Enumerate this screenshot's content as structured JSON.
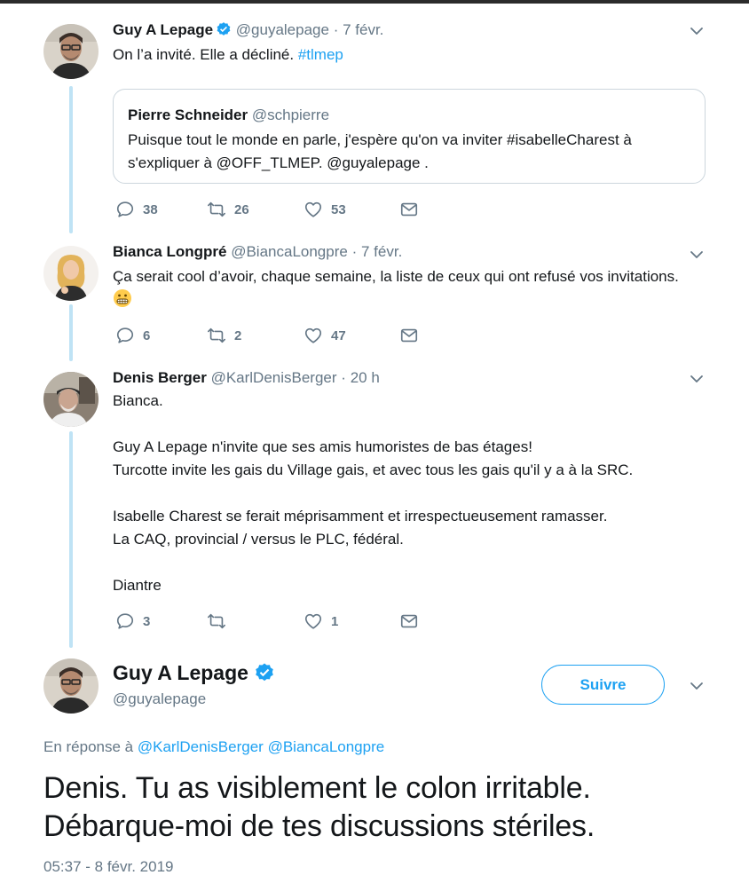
{
  "colors": {
    "accent": "#1da1f2",
    "muted": "#657786",
    "thread_line": "#bfe3f5",
    "border": "#ccd6dd"
  },
  "tweets": [
    {
      "name": "Guy A Lepage",
      "verified": true,
      "handle": "@guyalepage",
      "dot": "·",
      "time": "7 févr.",
      "text": "On l’a invité. Elle a décliné. ",
      "hashtag": "#tlmep",
      "quote": {
        "name": "Pierre Schneider",
        "handle": "@schpierre",
        "text": "Puisque tout le monde en parle, j'espère qu'on va inviter #isabelleCharest à s'expliquer à @OFF_TLMEP.  @guyalepage ."
      },
      "replies": "38",
      "retweets": "26",
      "likes": "53"
    },
    {
      "name": "Bianca Longpré",
      "handle": "@BiancaLongpre",
      "dot": "·",
      "time": "7 févr.",
      "text": "Ça serait cool d’avoir, chaque semaine, la liste de ceux qui ont refusé vos invitations.",
      "emoji": "grimacing-face",
      "replies": "6",
      "retweets": "2",
      "likes": "47"
    },
    {
      "name": "Denis Berger",
      "handle": "@KarlDenisBerger",
      "dot": "·",
      "time": "20 h",
      "lines": [
        "Bianca.",
        "",
        "Guy A Lepage n'invite que ses amis humoristes de bas étages!",
        "Turcotte invite les gais du Village gais, et avec tous les gais qu'il y a à la SRC.",
        "",
        "Isabelle Charest se ferait méprisamment et irrespectueusement ramasser.",
        "La CAQ, provincial / versus le PLC, fédéral.",
        "",
        "Diantre"
      ],
      "replies": "3",
      "retweets": "",
      "likes": "1"
    }
  ],
  "main": {
    "name": "Guy A Lepage",
    "verified": true,
    "handle": "@guyalepage",
    "follow_label": "Suivre",
    "reply_prefix": "En réponse à ",
    "reply_mentions": [
      "@KarlDenisBerger",
      "@BiancaLongpre"
    ],
    "text_line1": "Denis. Tu as visiblement le colon irritable.",
    "text_line2": "Débarque-moi de tes discussions stériles.",
    "timestamp": "05:37 - 8 févr. 2019"
  }
}
